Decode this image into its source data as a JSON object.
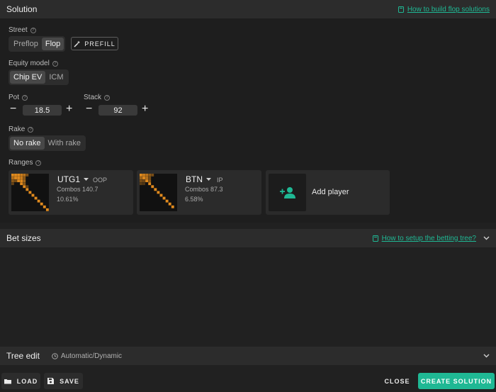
{
  "solution": {
    "title": "Solution",
    "help_link": "How to build flop solutions"
  },
  "street": {
    "label": "Street",
    "options": [
      "Preflop",
      "Flop"
    ],
    "selected": "Flop",
    "prefill_label": "PREFILL"
  },
  "equity_model": {
    "label": "Equity model",
    "options": [
      "Chip EV",
      "ICM"
    ],
    "selected": "Chip EV"
  },
  "pot": {
    "label": "Pot",
    "value": "18.5"
  },
  "stack": {
    "label": "Stack",
    "value": "92"
  },
  "rake": {
    "label": "Rake",
    "options": [
      "No rake",
      "With rake"
    ],
    "selected": "No rake"
  },
  "ranges": {
    "label": "Ranges",
    "players": [
      {
        "name": "UTG1",
        "position": "OOP",
        "combos": "Combos 140.7",
        "percent": "10.61%"
      },
      {
        "name": "BTN",
        "position": "IP",
        "combos": "Combos 87.3",
        "percent": "6.58%"
      }
    ],
    "add_player_label": "Add player"
  },
  "bet_sizes": {
    "title": "Bet sizes",
    "help_link": "How to setup the betting tree?"
  },
  "tree_edit": {
    "title": "Tree edit",
    "mode": "Automatic/Dynamic"
  },
  "footer": {
    "load_label": "LOAD",
    "save_label": "SAVE",
    "close_label": "CLOSE",
    "create_label": "CREATE SOLUTION"
  },
  "colors": {
    "accent": "#1fb894",
    "range_orange": "#e08a1e",
    "background": "#212121"
  },
  "icons": [
    "help-icon",
    "magic-wand-icon",
    "minus-icon",
    "plus-icon",
    "chevron-down-icon",
    "add-person-icon",
    "book-icon",
    "clock-icon",
    "folder-icon",
    "save-icon"
  ]
}
